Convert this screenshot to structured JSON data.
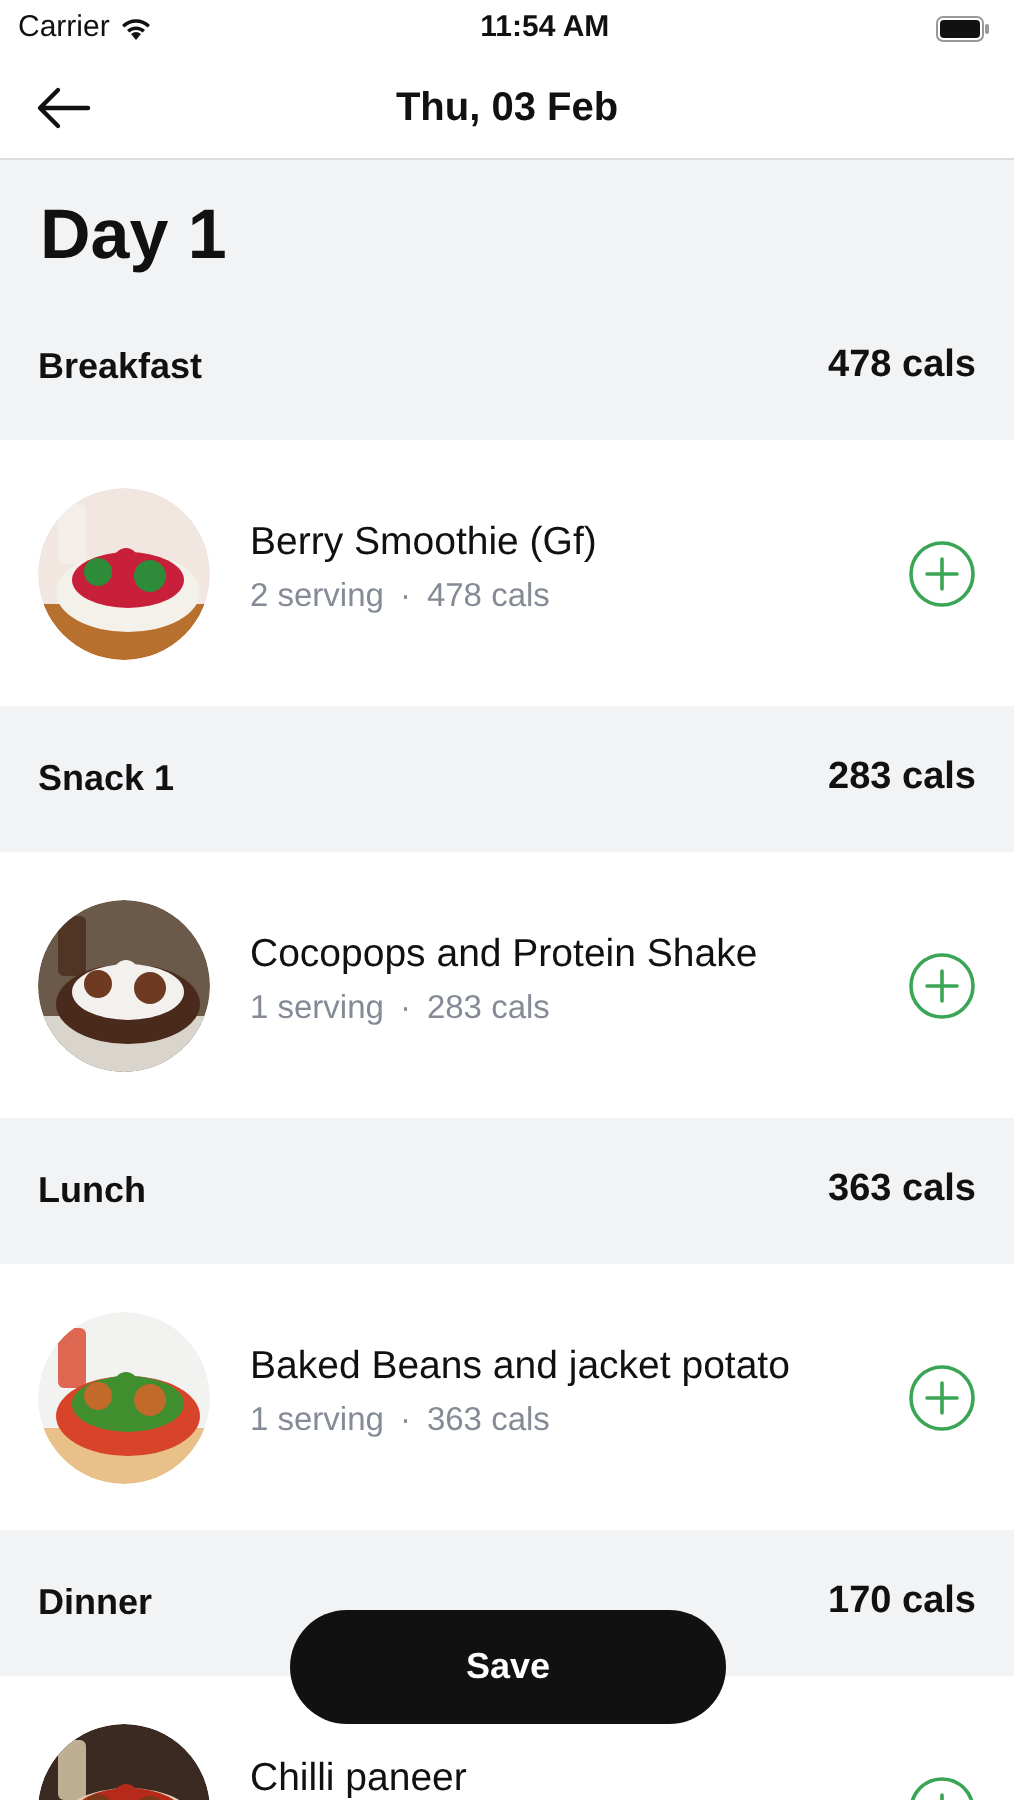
{
  "status_bar": {
    "carrier": "Carrier",
    "time": "11:54 AM"
  },
  "header": {
    "title": "Thu, 03 Feb"
  },
  "day_title": "Day 1",
  "meals": [
    {
      "name": "Breakfast",
      "calories": "478 cals",
      "items": [
        {
          "name": "Berry Smoothie (Gf)",
          "servings": "2 serving",
          "separator": "·",
          "calories": "478 cals"
        }
      ]
    },
    {
      "name": "Snack 1",
      "calories": "283 cals",
      "items": [
        {
          "name": "Cocopops and Protein Shake",
          "servings": "1 serving",
          "separator": "·",
          "calories": "283 cals"
        }
      ]
    },
    {
      "name": "Lunch",
      "calories": "363 cals",
      "items": [
        {
          "name": "Baked Beans and jacket potato",
          "servings": "1 serving",
          "separator": "·",
          "calories": "363 cals"
        }
      ]
    },
    {
      "name": "Dinner",
      "calories": "170 cals",
      "items": [
        {
          "name": "Chilli paneer"
        }
      ]
    }
  ],
  "save_button": "Save"
}
